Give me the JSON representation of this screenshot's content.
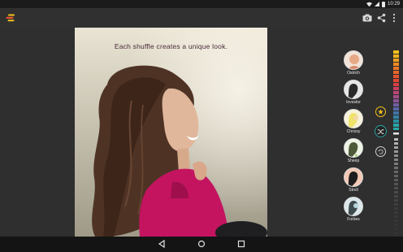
{
  "status_bar": {
    "time": "10:29",
    "icons": [
      "wifi-icon",
      "signal-icon",
      "battery-icon"
    ]
  },
  "app_bar": {
    "logo": "app-logo",
    "actions": [
      "camera-icon",
      "share-icon",
      "more-icon"
    ]
  },
  "photo": {
    "overlay_text": "Each shuffle creates a unique look."
  },
  "presets": [
    {
      "label": "Ostrich",
      "thumb_color": "#e8a987"
    },
    {
      "label": "Investor",
      "thumb_color": "#2a2a2a"
    },
    {
      "label": "Chrissy",
      "thumb_color": "#f0e36a"
    },
    {
      "label": "Sheep",
      "thumb_color": "#cfe3b9"
    },
    {
      "label": "Stroll",
      "thumb_color": "#1e1e1e"
    },
    {
      "label": "Forbes",
      "thumb_color": "#b9d6dc"
    }
  ],
  "actions": {
    "favorite": "star-icon",
    "shuffle": "shuffle-icon",
    "reset": "reset-icon"
  },
  "colors": {
    "accent_teal": "#29a7a5",
    "accent_gold": "#f3c21a",
    "background": "#2f2f2f"
  },
  "nav_bar": {
    "buttons": [
      "back-icon",
      "home-icon",
      "recent-apps-icon"
    ]
  }
}
